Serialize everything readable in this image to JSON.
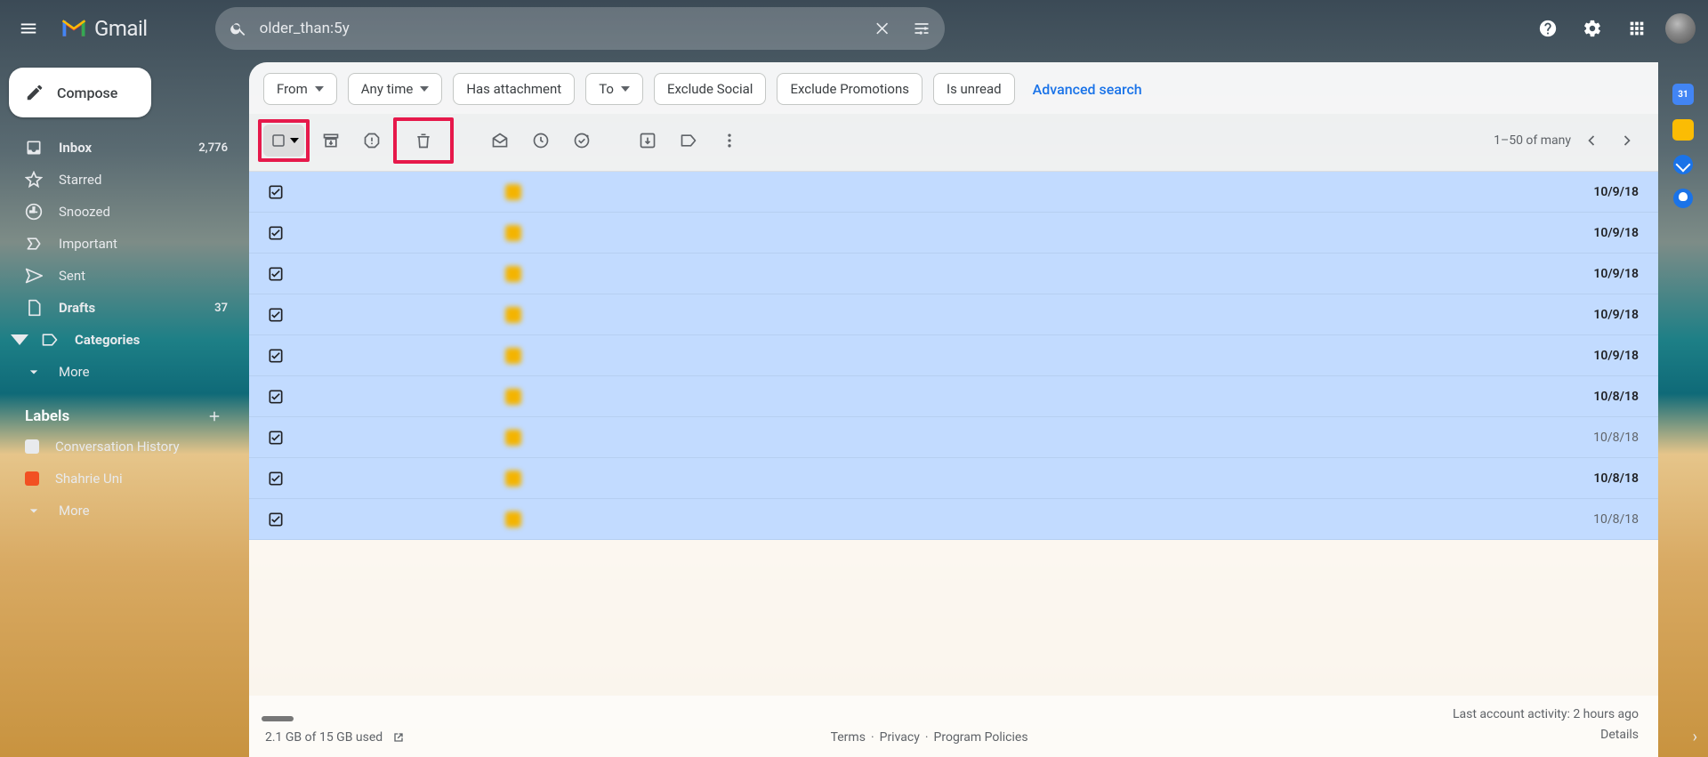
{
  "app_name": "Gmail",
  "search_value": "older_than:5y",
  "compose_label": "Compose",
  "sidebar": {
    "items": [
      {
        "icon": "inbox",
        "label": "Inbox",
        "count": "2,776",
        "bold": true
      },
      {
        "icon": "star",
        "label": "Starred",
        "count": "",
        "bold": false
      },
      {
        "icon": "clock",
        "label": "Snoozed",
        "count": "",
        "bold": false
      },
      {
        "icon": "important",
        "label": "Important",
        "count": "",
        "bold": false
      },
      {
        "icon": "send",
        "label": "Sent",
        "count": "",
        "bold": false
      },
      {
        "icon": "draft",
        "label": "Drafts",
        "count": "37",
        "bold": true
      },
      {
        "icon": "category",
        "label": "Categories",
        "count": "",
        "bold": true,
        "caret": true
      },
      {
        "icon": "chevron",
        "label": "More",
        "count": "",
        "bold": false
      }
    ],
    "labels_title": "Labels",
    "labels": [
      {
        "color": "#e8eaed",
        "label": "Conversation History"
      },
      {
        "color": "#f25022",
        "label": "Shahrie Uni"
      }
    ],
    "labels_more": "More"
  },
  "chips": [
    {
      "label": "From",
      "dropdown": true
    },
    {
      "label": "Any time",
      "dropdown": true
    },
    {
      "label": "Has attachment",
      "dropdown": false
    },
    {
      "label": "To",
      "dropdown": true
    },
    {
      "label": "Exclude Social",
      "dropdown": false
    },
    {
      "label": "Exclude Promotions",
      "dropdown": false
    },
    {
      "label": "Is unread",
      "dropdown": false
    }
  ],
  "advanced_search": "Advanced search",
  "pager_text": "1–50 of many",
  "rows": [
    {
      "date": "10/9/18",
      "bold": true
    },
    {
      "date": "10/9/18",
      "bold": true
    },
    {
      "date": "10/9/18",
      "bold": true
    },
    {
      "date": "10/9/18",
      "bold": true
    },
    {
      "date": "10/9/18",
      "bold": true
    },
    {
      "date": "10/8/18",
      "bold": true
    },
    {
      "date": "10/8/18",
      "bold": false
    },
    {
      "date": "10/8/18",
      "bold": true
    },
    {
      "date": "10/8/18",
      "bold": false
    }
  ],
  "footer": {
    "storage": "2.1 GB of 15 GB used",
    "links": [
      "Terms",
      "Privacy",
      "Program Policies"
    ],
    "activity": "Last account activity: 2 hours ago",
    "details": "Details"
  }
}
